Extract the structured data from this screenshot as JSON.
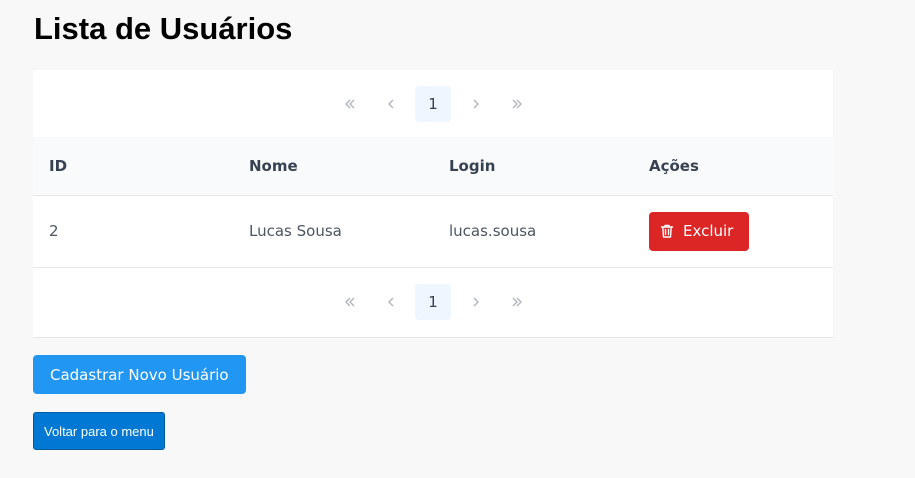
{
  "page": {
    "title": "Lista de Usuários"
  },
  "paginator": {
    "first_icon": "double-chevron-left-icon",
    "prev_icon": "chevron-left-icon",
    "current_page": "1",
    "next_icon": "chevron-right-icon",
    "last_icon": "double-chevron-right-icon"
  },
  "table": {
    "headers": {
      "id": "ID",
      "nome": "Nome",
      "login": "Login",
      "acoes": "Ações"
    },
    "rows": [
      {
        "id": "2",
        "nome": "Lucas Sousa",
        "login": "lucas.sousa",
        "action_label": "Excluir",
        "action_icon": "trash-icon"
      }
    ]
  },
  "actions": {
    "register_label": "Cadastrar Novo Usuário",
    "back_label": "Voltar para o menu"
  },
  "colors": {
    "danger": "#dc2626",
    "primary": "#2196f3",
    "menu_button": "#0078d4",
    "page_highlight": "#eef6ff"
  }
}
